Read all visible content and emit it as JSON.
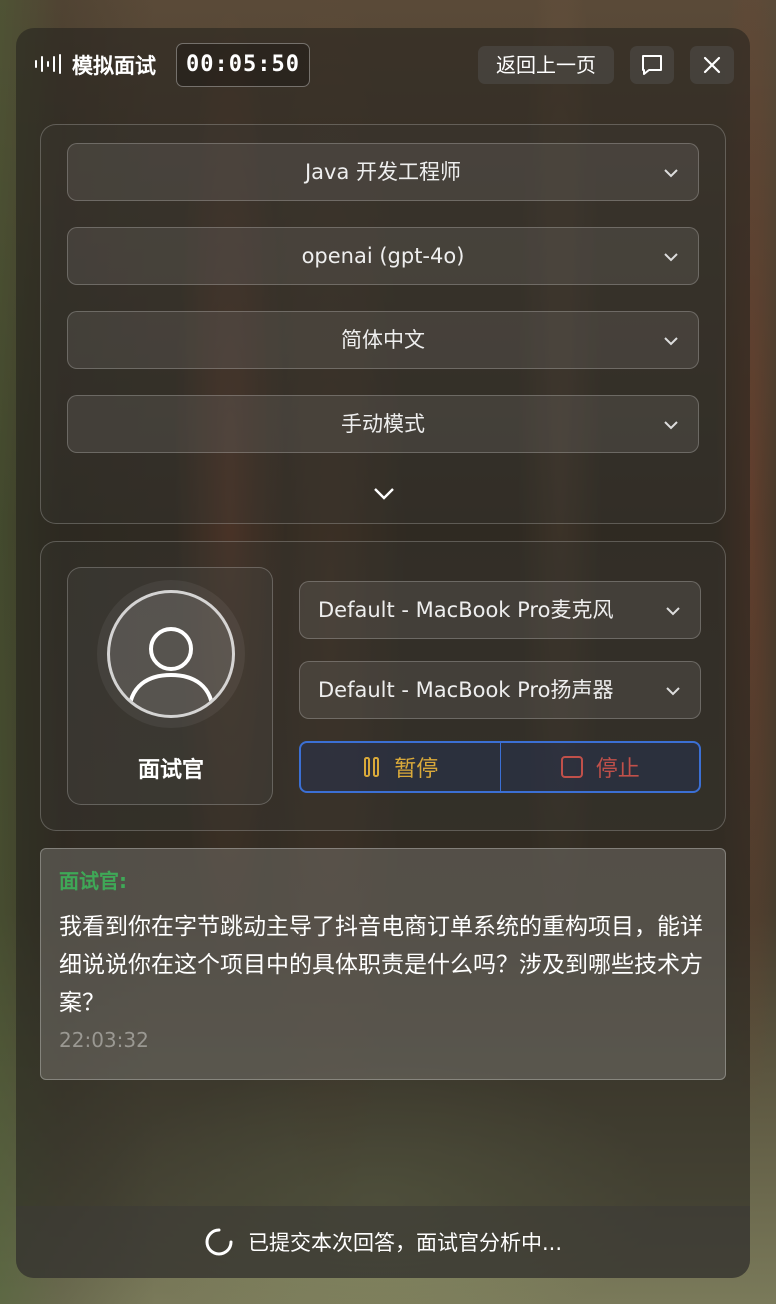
{
  "header": {
    "title": "模拟面试",
    "timer": "00:05:50",
    "back_label": "返回上一页"
  },
  "settings": {
    "position": "Java 开发工程师",
    "model": "openai (gpt-4o)",
    "language": "简体中文",
    "mode": "手动模式"
  },
  "audio": {
    "interviewer_label": "面试官",
    "microphone": "Default - MacBook Pro麦克风",
    "speaker": "Default - MacBook Pro扬声器",
    "pause_label": "暂停",
    "stop_label": "停止"
  },
  "messages": [
    {
      "speaker": "面试官:",
      "text": "我看到你在字节跳动主导了抖音电商订单系统的重构项目，能详细说说你在这个项目中的具体职责是什么吗？涉及到哪些技术方案？",
      "time": "22:03:32"
    }
  ],
  "status": {
    "text": "已提交本次回答，面试官分析中..."
  },
  "colors": {
    "accent_blue": "#3b6fd4",
    "pause": "#d9a93a",
    "stop": "#c0504a",
    "speaker": "#3fa857"
  },
  "icons": [
    "waveform-icon",
    "chat-icon",
    "close-icon",
    "chevron-down-icon",
    "user-icon",
    "pause-icon",
    "stop-icon",
    "spinner-icon"
  ]
}
